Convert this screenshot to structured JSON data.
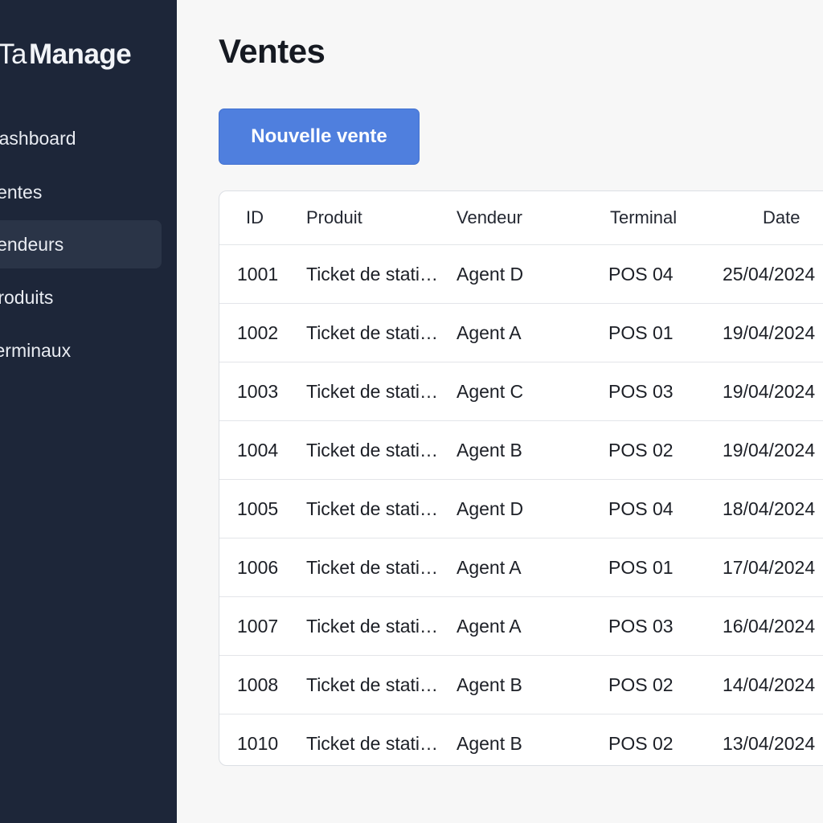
{
  "brand": {
    "part1": "nTa",
    "part2": "Manage"
  },
  "sidebar": {
    "items": [
      {
        "label": "Dashboard",
        "id": "dashboard"
      },
      {
        "label": "Ventes",
        "id": "ventes"
      },
      {
        "label": "Vendeurs",
        "id": "vendeurs",
        "active": true
      },
      {
        "label": "Produits",
        "id": "produits"
      },
      {
        "label": "Terminaux",
        "id": "terminaux"
      }
    ]
  },
  "main": {
    "title": "Ventes",
    "new_sale_button": "Nouvelle vente",
    "table": {
      "headers": {
        "id": "ID",
        "produit": "Produit",
        "vendeur": "Vendeur",
        "terminal": "Terminal",
        "date": "Date"
      },
      "rows": [
        {
          "id": "1001",
          "produit": "Ticket de stationnement",
          "vendeur": "Agent D",
          "terminal": "POS 04",
          "date": "25/04/2024"
        },
        {
          "id": "1002",
          "produit": "Ticket de stationnement",
          "vendeur": "Agent A",
          "terminal": "POS 01",
          "date": "19/04/2024"
        },
        {
          "id": "1003",
          "produit": "Ticket de stationnement",
          "vendeur": "Agent C",
          "terminal": "POS 03",
          "date": "19/04/2024"
        },
        {
          "id": "1004",
          "produit": "Ticket de stationnement",
          "vendeur": "Agent B",
          "terminal": "POS 02",
          "date": "19/04/2024"
        },
        {
          "id": "1005",
          "produit": "Ticket de stationnement",
          "vendeur": "Agent D",
          "terminal": "POS 04",
          "date": "18/04/2024"
        },
        {
          "id": "1006",
          "produit": "Ticket de stationnement",
          "vendeur": "Agent A",
          "terminal": "POS 01",
          "date": "17/04/2024"
        },
        {
          "id": "1007",
          "produit": "Ticket de stationnement",
          "vendeur": "Agent A",
          "terminal": "POS 03",
          "date": "16/04/2024"
        },
        {
          "id": "1008",
          "produit": "Ticket de stationnement",
          "vendeur": "Agent B",
          "terminal": "POS 02",
          "date": "14/04/2024"
        },
        {
          "id": "1010",
          "produit": "Ticket de stationnement",
          "vendeur": "Agent B",
          "terminal": "POS 02",
          "date": "13/04/2024"
        }
      ]
    }
  },
  "colors": {
    "sidebar_bg": "#1d2639",
    "sidebar_active": "#2a3447",
    "accent": "#4f7fde",
    "page_bg": "#f7f7f7"
  }
}
